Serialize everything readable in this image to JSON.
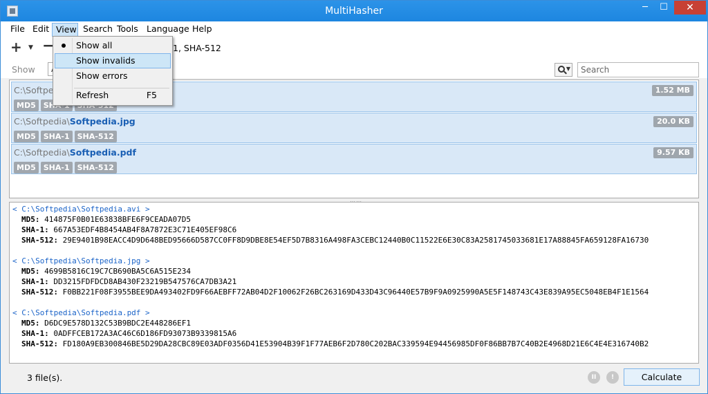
{
  "window": {
    "title": "MultiHasher",
    "minimize": "─",
    "maximize": "☐",
    "close": "✕"
  },
  "menu": {
    "file": "File",
    "edit": "Edit",
    "view": "View",
    "search": "Search",
    "tools": "Tools",
    "language": "Language",
    "help": "Help"
  },
  "toolbar": {
    "add": "+",
    "add_arrow": "▼",
    "remove": "−",
    "algorithms_visible": "1, SHA-512"
  },
  "filter": {
    "show_label": "Show",
    "show_value": "A",
    "search_placeholder": "Search"
  },
  "files": [
    {
      "dir": "C:\\Softpedia",
      "name": "",
      "size": "1.52 MB",
      "algos": [
        "MD5",
        "SHA-1",
        "SHA-512"
      ]
    },
    {
      "dir": "C:\\Softpedia\\",
      "name": "Softpedia.jpg",
      "size": "20.0 KB",
      "algos": [
        "MD5",
        "SHA-1",
        "SHA-512"
      ]
    },
    {
      "dir": "C:\\Softpedia\\",
      "name": "Softpedia.pdf",
      "size": "9.57 KB",
      "algos": [
        "MD5",
        "SHA-1",
        "SHA-512"
      ]
    }
  ],
  "results": [
    {
      "path": "< C:\\Softpedia\\Softpedia.avi >",
      "md5_label": "MD5:",
      "md5": "414875F0B01E63838BFE6F9CEADA07D5",
      "sha1_label": "SHA-1:",
      "sha1": "667A53EDF4B8454AB4F8A7872E3C71E405EF98C6",
      "sha512_label": "SHA-512:",
      "sha512": "29E9401B98EACC4D9D648BED95666D587CC0FF8D9DBE8E54EF5D7B8316A498FA3CEBC12440B0C11522E6E30C83A2581745033681E17A88845FA659128FA16730"
    },
    {
      "path": "< C:\\Softpedia\\Softpedia.jpg >",
      "md5_label": "MD5:",
      "md5": "4699B5816C19C7CB690BA5C6A515E234",
      "sha1_label": "SHA-1:",
      "sha1": "DD3215FDFDCD8AB430F23219B547576CA7DB3A21",
      "sha512_label": "SHA-512:",
      "sha512": "F0BB221F08F3955BEE9DA493402FD9F66AEBFF72AB04D2F10062F26BC263169D433D43C96440E57B9F9A0925990A5E5F148743C43E839A95EC5048EB4F1E1564"
    },
    {
      "path": "< C:\\Softpedia\\Softpedia.pdf >",
      "md5_label": "MD5:",
      "md5": "D6DC9E578D132C53B9BDC2E448286EF1",
      "sha1_label": "SHA-1:",
      "sha1": "0ADFFCEB172A3AC46C6D186FD93073B9339815A6",
      "sha512_label": "SHA-512:",
      "sha512": "FD180A9EB300846BE5D29DA28CBC89E03ADF0356D41E53904B39F1F77AEB6F2D780C202BAC339594E94456985DF0F86BB7B7C40B2E4968D21E6C4E4E316740B2"
    }
  ],
  "status": {
    "file_count": "3 file(s).",
    "pause_icon": "II",
    "info_icon": "!",
    "calculate": "Calculate"
  },
  "view_menu": {
    "show_all": "Show all",
    "show_invalids": "Show invalids",
    "show_errors": "Show errors",
    "refresh": "Refresh",
    "refresh_shortcut": "F5"
  },
  "colors": {
    "titlebar": "#1d86e0",
    "selection": "#d9e8f7",
    "path_link": "#1a63c8",
    "tag_bg": "#a1a7ae"
  }
}
